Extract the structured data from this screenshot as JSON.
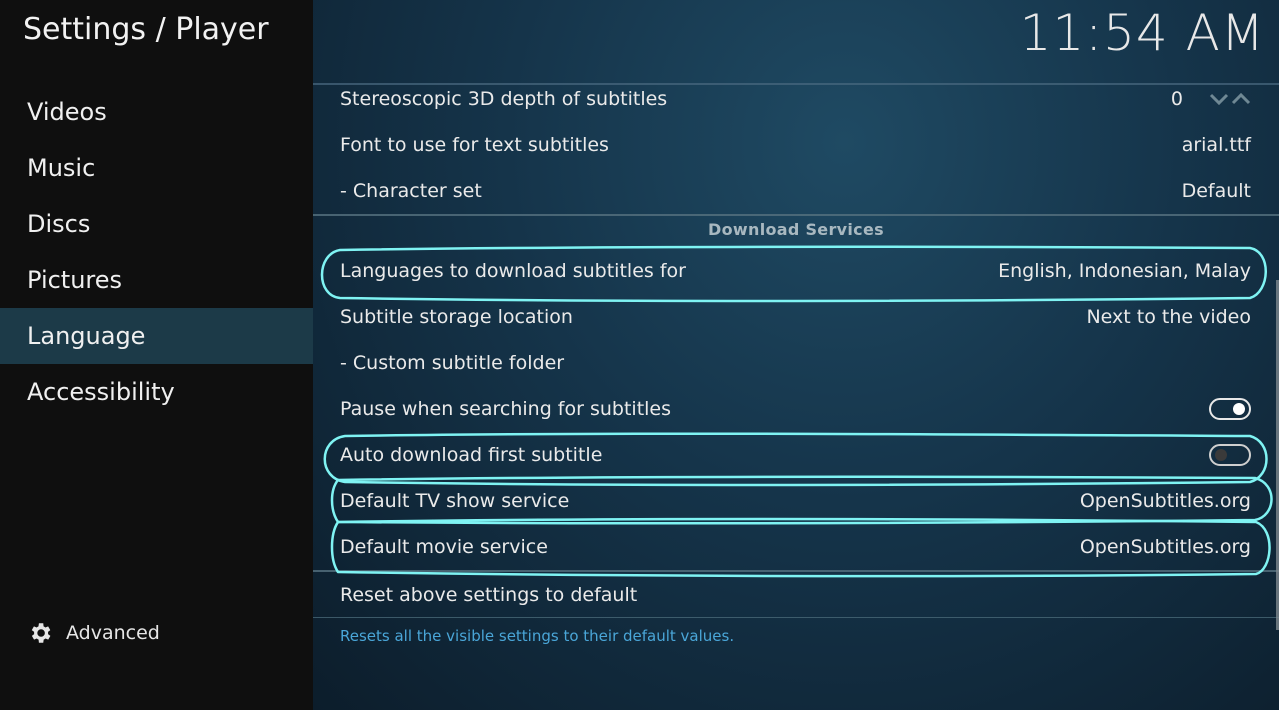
{
  "header": {
    "title": "Settings / Player",
    "clock": "11:54 AM"
  },
  "sidebar": {
    "items": [
      {
        "label": "Videos"
      },
      {
        "label": "Music"
      },
      {
        "label": "Discs"
      },
      {
        "label": "Pictures"
      },
      {
        "label": "Language",
        "active": true
      },
      {
        "label": "Accessibility"
      }
    ],
    "advanced_label": "Advanced"
  },
  "settings": {
    "stereo_depth": {
      "label": "Stereoscopic 3D depth of subtitles",
      "value": "0"
    },
    "font": {
      "label": "Font to use for text subtitles",
      "value": "arial.ttf"
    },
    "charset": {
      "label": "- Character set",
      "value": "Default"
    },
    "group_title": "Download Services",
    "languages": {
      "label": "Languages to download subtitles for",
      "value": "English, Indonesian, Malay"
    },
    "storage": {
      "label": "Subtitle storage location",
      "value": "Next to the video"
    },
    "custom_folder": {
      "label": "- Custom subtitle folder"
    },
    "pause_search": {
      "label": "Pause when searching for subtitles",
      "enabled": true
    },
    "auto_download": {
      "label": "Auto download first subtitle",
      "enabled": false
    },
    "tv_service": {
      "label": "Default TV show service",
      "value": "OpenSubtitles.org"
    },
    "movie_service": {
      "label": "Default movie service",
      "value": "OpenSubtitles.org"
    },
    "reset": {
      "label": "Reset above settings to default"
    }
  },
  "description": "Resets all the visible settings to their default values.",
  "colors": {
    "accent": "#1c3a48",
    "description": "#4aa6d8",
    "annotation": "#7ff3f3"
  }
}
